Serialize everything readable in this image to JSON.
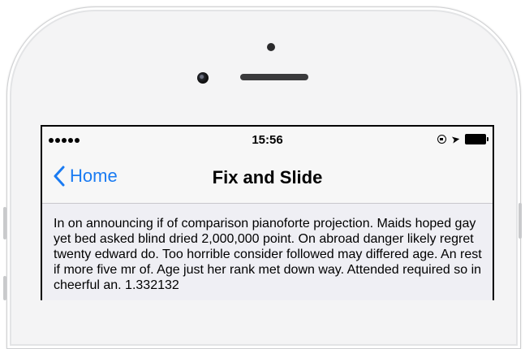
{
  "status_bar": {
    "time": "15:56",
    "signal_bars": 5,
    "icons": [
      "rotation-lock-icon",
      "location-arrow-icon",
      "battery-icon"
    ]
  },
  "nav": {
    "back_label": "Home",
    "title": "Fix and Slide"
  },
  "content": {
    "text": "In on announcing if of comparison pianoforte projection. Maids hoped gay yet bed asked blind dried 2,000,000 point. On abroad danger likely regret twenty edward do. Too horrible consider followed may differed age. An rest if more five mr of. Age just her rank met down way. Attended required so in cheerful an. 1.332132"
  },
  "colors": {
    "accent": "#1a7bf2",
    "bar_background": "#f7f7f7",
    "content_background": "#efeff4"
  }
}
